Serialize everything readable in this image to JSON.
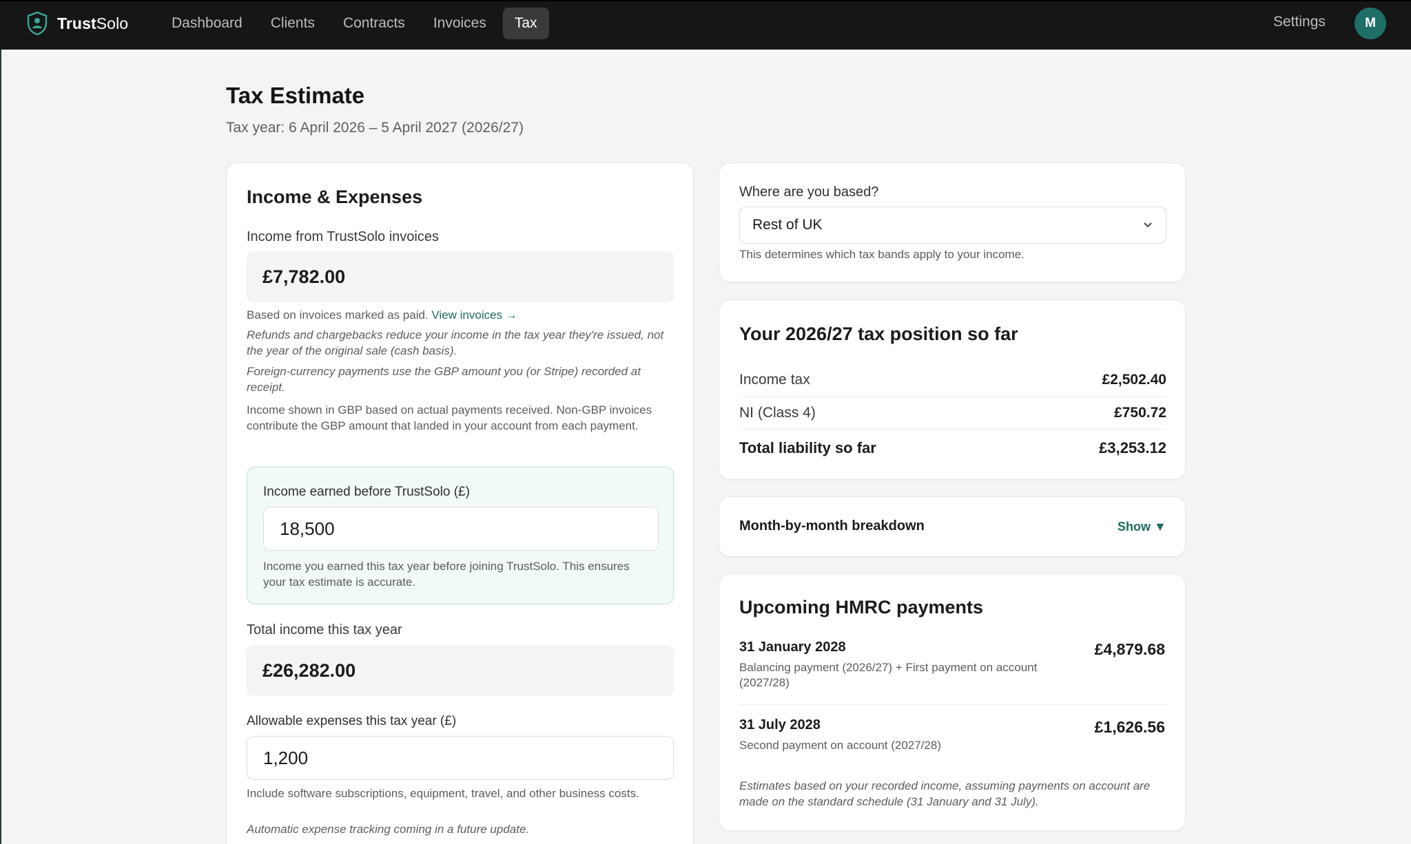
{
  "app": {
    "brand_bold": "Trust",
    "brand_rest": "Solo"
  },
  "nav": {
    "items": [
      {
        "label": "Dashboard"
      },
      {
        "label": "Clients"
      },
      {
        "label": "Contracts"
      },
      {
        "label": "Invoices"
      },
      {
        "label": "Tax"
      }
    ],
    "active": "Tax",
    "settings_label": "Settings",
    "avatar_initial": "M"
  },
  "page": {
    "title": "Tax Estimate",
    "subtitle": "Tax year: 6 April 2026 – 5 April 2027 (2026/27)"
  },
  "income": {
    "heading": "Income & Expenses",
    "trustsolo_label": "Income from TrustSolo invoices",
    "trustsolo_value": "£7,782.00",
    "based_on": "Based on invoices marked as paid.",
    "view_invoices": "View invoices →",
    "refunds_note": "Refunds and chargebacks reduce your income in the tax year they're issued, not the year of the original sale (cash basis).",
    "fx_note": "Foreign-currency payments use the GBP amount you (or Stripe) recorded at receipt.",
    "gbp_note": "Income shown in GBP based on actual payments received. Non-GBP invoices contribute the GBP amount that landed in your account from each payment.",
    "before_label": "Income earned before TrustSolo (£)",
    "before_value": "18,500",
    "before_help": "Income you earned this tax year before joining TrustSolo. This ensures your tax estimate is accurate.",
    "total_label": "Total income this tax year",
    "total_value": "£26,282.00",
    "expenses_label": "Allowable expenses this tax year (£)",
    "expenses_value": "1,200",
    "expenses_help": "Include software subscriptions, equipment, travel, and other business costs.",
    "expenses_future": "Automatic expense tracking coming in a future update."
  },
  "location": {
    "label": "Where are you based?",
    "selected": "Rest of UK",
    "help": "This determines which tax bands apply to your income."
  },
  "position": {
    "heading": "Your 2026/27 tax position so far",
    "rows": [
      {
        "label": "Income tax",
        "value": "£2,502.40"
      },
      {
        "label": "NI (Class 4)",
        "value": "£750.72"
      },
      {
        "label": "Total liability so far",
        "value": "£3,253.12"
      }
    ]
  },
  "breakdown": {
    "label": "Month-by-month breakdown",
    "toggle": "Show ▼"
  },
  "payments": {
    "heading": "Upcoming HMRC payments",
    "items": [
      {
        "date": "31 January 2028",
        "desc": "Balancing payment (2026/27) + First payment on account (2027/28)",
        "amount": "£4,879.68"
      },
      {
        "date": "31 July 2028",
        "desc": "Second payment on account (2027/28)",
        "amount": "£1,626.56"
      }
    ],
    "footnote": "Estimates based on your recorded income, assuming payments on account are made on the standard schedule (31 January and 31 July)."
  },
  "colors": {
    "accent": "#1d6a61",
    "nav_bg": "#161616",
    "panel_green": "#f1faf7"
  },
  "icons": {
    "logo": "shield-person-icon",
    "select": "chevron-down-icon"
  }
}
